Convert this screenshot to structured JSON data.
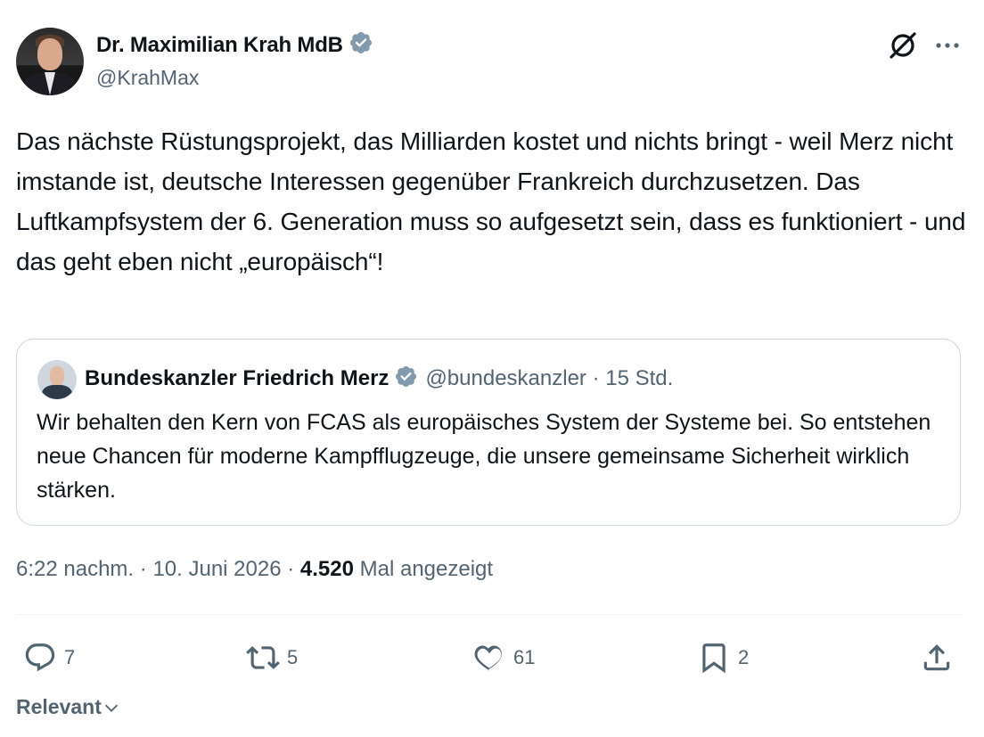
{
  "author": {
    "name": "Dr. Maximilian Krah MdB",
    "handle": "@KrahMax",
    "verified": true
  },
  "tweet": {
    "text": "Das nächste Rüstungsprojekt, das Milliarden kostet und nichts bringt - weil Merz nicht imstande ist, deutsche Interessen gegenüber Frankreich durchzusetzen. Das Luftkampfsystem der 6. Generation muss so aufgesetzt sein, dass es funktioniert - und das geht eben nicht „europäisch“!"
  },
  "quote": {
    "name": "Bundeskanzler Friedrich Merz",
    "handle": "@bundeskanzler",
    "separator": "·",
    "time": "15 Std.",
    "verified": true,
    "text": "Wir behalten den Kern von FCAS als europäisches System der Systeme bei. So entstehen neue Chancen für moderne Kampfflugzeuge, die unsere gemeinsame Sicherheit wirklich stärken."
  },
  "meta": {
    "time": "6:22 nachm.",
    "date": "10. Juni 2026",
    "separator": "·",
    "views_count": "4.520",
    "views_label": "Mal angezeigt"
  },
  "actions": {
    "replies": "7",
    "reposts": "5",
    "likes": "61",
    "bookmarks": "2"
  },
  "sort": {
    "label": "Relevant"
  },
  "icons": {
    "verified": "verified-badge-icon",
    "grok": "grok-icon",
    "more": "more-icon",
    "reply": "reply-icon",
    "repost": "repost-icon",
    "like": "heart-icon",
    "bookmark": "bookmark-icon",
    "share": "share-icon",
    "chevron": "chevron-down-icon"
  },
  "colors": {
    "text": "#0f1419",
    "secondary": "#536471",
    "verified_badge": "#829aab",
    "border": "#cfd9de"
  }
}
